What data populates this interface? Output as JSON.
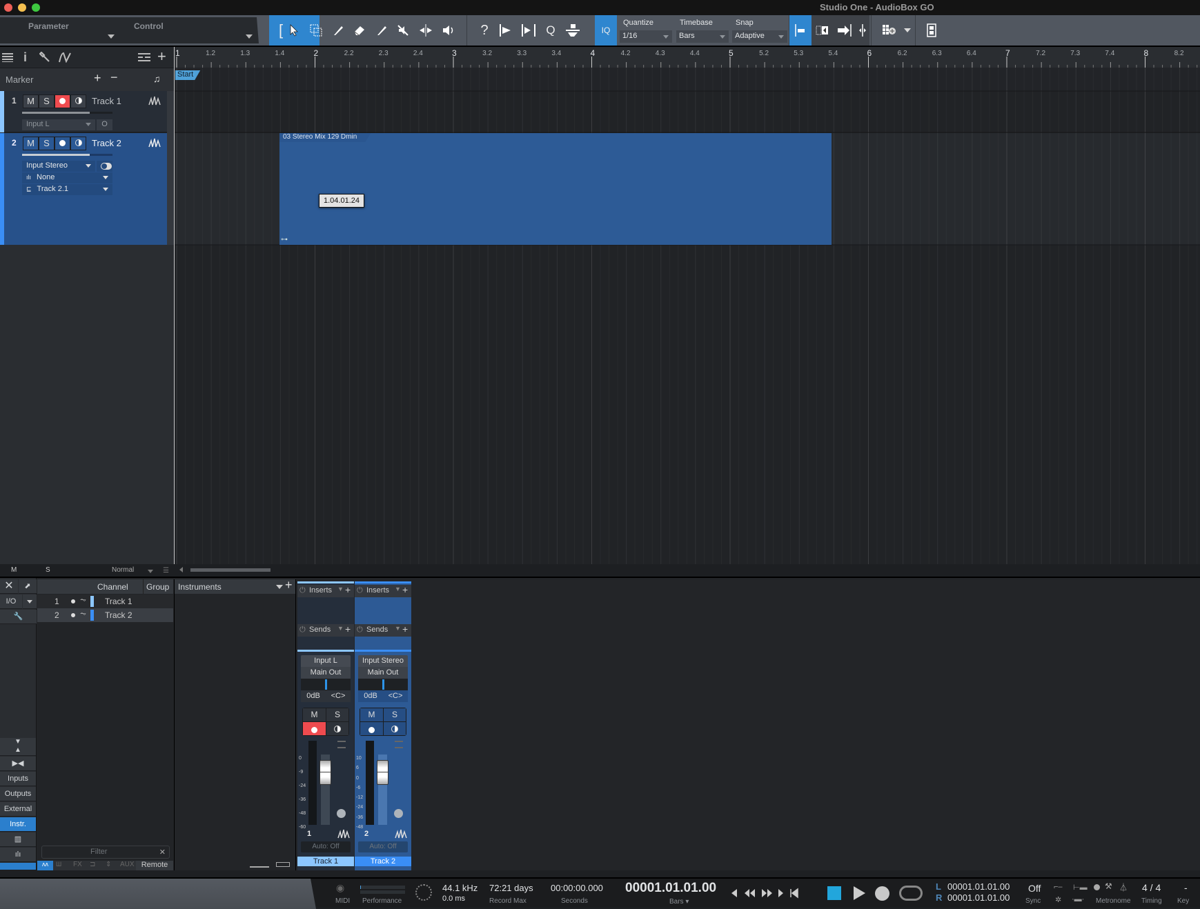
{
  "window": {
    "title": "Studio One - AudioBox GO",
    "traffic_lights": {
      "close": "#ed5f57",
      "minimize": "#f4bf4f",
      "zoom": "#3ec840"
    }
  },
  "toolbar": {
    "parameter_label": "Parameter",
    "control_label": "Control",
    "tools": [
      {
        "name": "range-bracket-icon",
        "glyph": "["
      },
      {
        "name": "arrow-tool-icon",
        "glyph": "➚"
      },
      {
        "name": "range-tool-icon",
        "glyph": "⬚"
      },
      {
        "name": "split-tool-icon",
        "glyph": "✎"
      },
      {
        "name": "eraser-tool-icon",
        "glyph": "◈"
      },
      {
        "name": "paint-tool-icon",
        "glyph": "✐"
      },
      {
        "name": "mute-tool-icon",
        "glyph": "✕"
      },
      {
        "name": "bend-tool-icon",
        "glyph": "⇹"
      },
      {
        "name": "listen-tool-icon",
        "glyph": "🔈"
      }
    ],
    "edit_tools": [
      {
        "name": "help-icon",
        "glyph": "?"
      },
      {
        "name": "quantize-insert-icon",
        "glyph": "⊳"
      },
      {
        "name": "quantize-split-icon",
        "glyph": "⇼"
      },
      {
        "name": "quantize-q-icon",
        "glyph": "Q"
      },
      {
        "name": "bounce-icon",
        "glyph": "⏚"
      }
    ],
    "iq_label": "IQ",
    "quantize": {
      "label": "Quantize",
      "value": "1/16"
    },
    "timebase": {
      "label": "Timebase",
      "value": "Bars"
    },
    "snap": {
      "label": "Snap",
      "value": "Adaptive"
    }
  },
  "track_list_header": {
    "marker_label": "Marker"
  },
  "ruler": {
    "ticks": [
      "1",
      "1.2",
      "1.3",
      "1.4",
      "2",
      "2.2",
      "2.3",
      "2.4",
      "3",
      "3.2",
      "3.3",
      "3.4",
      "4",
      "4.2",
      "4.3",
      "4.4",
      "5",
      "5.2",
      "5.3",
      "5.4",
      "6",
      "6.2",
      "6.3",
      "6.4",
      "7",
      "7.2",
      "7.3",
      "7.4",
      "8",
      "8.2"
    ],
    "start_marker": "Start"
  },
  "tracks": [
    {
      "number": "1",
      "name": "Track 1",
      "mute": "M",
      "solo": "S",
      "record_armed": true,
      "input": "Input L",
      "selected": false
    },
    {
      "number": "2",
      "name": "Track 2",
      "mute": "M",
      "solo": "S",
      "record_armed": false,
      "input": "Input Stereo",
      "instrument": "None",
      "layer": "Track 2.1",
      "selected": true
    }
  ],
  "event": {
    "name": "03 Stereo Mix 129 Dmin",
    "tooltip": "1.04.01.24"
  },
  "arrange_footer": {
    "m_label": "M",
    "s_label": "S",
    "mode": "Normal"
  },
  "mixer": {
    "nav": {
      "io_label": "I/O",
      "buttons": [
        "Inputs",
        "Outputs",
        "External",
        "Instr."
      ],
      "active": "Instr."
    },
    "channel_list": {
      "col_channel": "Channel",
      "col_group": "Group",
      "rows": [
        {
          "num": "1",
          "name": "Track 1",
          "color": "#8cc6ff"
        },
        {
          "num": "2",
          "name": "Track 2",
          "color": "#3a8ef5"
        }
      ],
      "filter_placeholder": "Filter",
      "tabs": [
        "FX",
        "AUX"
      ],
      "remote_label": "Remote"
    },
    "instruments_label": "Instruments",
    "channels": [
      {
        "inserts_label": "Inserts",
        "sends_label": "Sends",
        "input": "Input L",
        "output": "Main Out",
        "volume": "0dB",
        "pan": "<C>",
        "mute": "M",
        "solo": "S",
        "record_armed": true,
        "meter_scale": [
          "0",
          "-9",
          "-24",
          "-36",
          "-48",
          "-60"
        ],
        "number": "1",
        "automation": "Auto: Off",
        "name": "Track 1",
        "name_color": "#8cc6ff"
      },
      {
        "inserts_label": "Inserts",
        "sends_label": "Sends",
        "input": "Input Stereo",
        "output": "Main Out",
        "volume": "0dB",
        "pan": "<C>",
        "mute": "M",
        "solo": "S",
        "record_armed": false,
        "meter_scale": [
          "10",
          "6",
          "0",
          "-6",
          "-12",
          "-24",
          "-36",
          "-48"
        ],
        "number": "2",
        "automation": "Auto: Off",
        "name": "Track 2",
        "name_color": "#3a8ef5"
      }
    ]
  },
  "transport": {
    "midi_label": "MIDI",
    "performance_label": "Performance",
    "sample_rate": "44.1 kHz",
    "latency": "0.0 ms",
    "record_max_value": "72:21 days",
    "record_max_label": "Record Max",
    "seconds_value": "00:00:00.000",
    "seconds_label": "Seconds",
    "bars_value": "00001.01.01.00",
    "bars_label": "Bars",
    "loop_left": "00001.01.01.00",
    "loop_right": "00001.01.01.00",
    "l_label": "L",
    "r_label": "R",
    "sync_value": "Off",
    "sync_label": "Sync",
    "metronome_label": "Metronome",
    "timing_value": "4 / 4",
    "timing_label": "Timing",
    "key_value": "-",
    "key_label": "Key"
  }
}
